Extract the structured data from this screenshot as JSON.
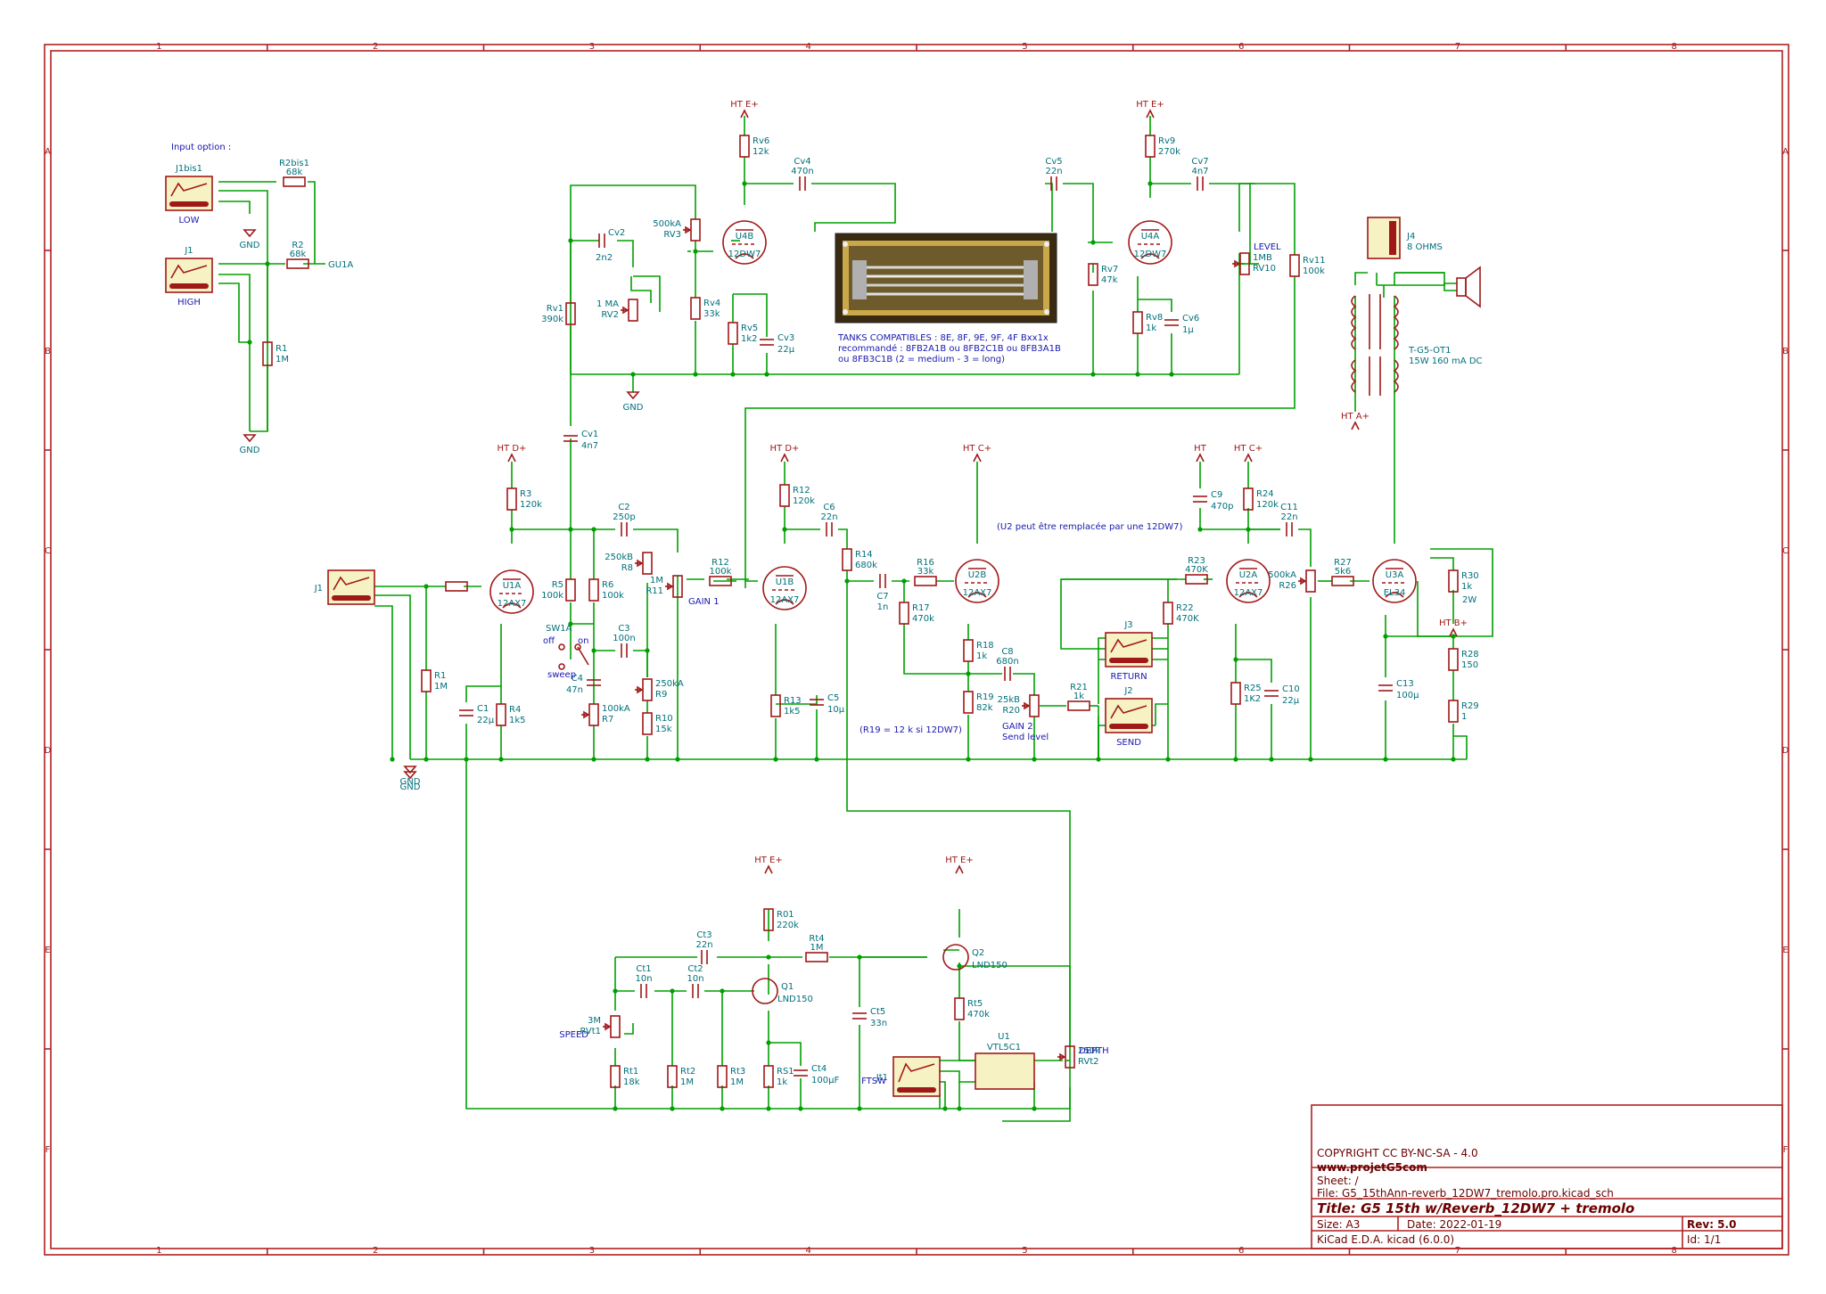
{
  "title_block": {
    "copyright": "COPYRIGHT   CC BY-NC-SA - 4.0",
    "website": "www.projetG5com",
    "sheet": "Sheet: /",
    "file": "File: G5_15thAnn-reverb_12DW7_tremolo.pro.kicad_sch",
    "title": "Title: G5 15th w/Reverb_12DW7 + tremolo",
    "size": "Size: A3",
    "date": "Date: 2022-01-19",
    "rev": "Rev: 5.0",
    "tool": "KiCad E.D.A.  kicad (6.0.0)",
    "id": "Id: 1/1"
  },
  "grid": {
    "columns": [
      "1",
      "2",
      "3",
      "4",
      "5",
      "6",
      "7",
      "8"
    ],
    "rows": [
      "A",
      "B",
      "C",
      "D",
      "E",
      "F"
    ]
  },
  "notes": {
    "input_option": "Input option :",
    "tanks_1": "TANKS COMPATIBLES :  8E, 8F, 9E, 9F, 4F     Bxx1x",
    "tanks_2": "recommandé :   8FB2A1B ou 8FB2C1B ou 8FB3A1B",
    "tanks_3": "ou 8FB3C1B   (2 = medium -  3 = long)",
    "u2_note": "(U2 peut être remplacée par une 12DW7)",
    "r19_note": "(R19 = 12 k si 12DW7)",
    "level": "LEVEL",
    "gain1": "GAIN 1",
    "gain2": "GAIN 2",
    "send_level": "Send level",
    "speed": "SPEED",
    "depth": "DEPTH",
    "low": "LOW",
    "high": "HIGH",
    "return": "RETURN",
    "send": "SEND",
    "ftsw": "FTSW",
    "sw_off": "off",
    "sw_on": "on",
    "sw_sweep": "sweep"
  },
  "nets": {
    "gnd": "GND",
    "ht_e": "HT E+",
    "ht_d": "HT D+",
    "ht_c": "HT C+",
    "ht_b": "HT B+",
    "ht_a": "HT A+",
    "ht": "HT",
    "gu1a": "GU1A"
  },
  "components": [
    {
      "ref": "J1bis1",
      "value": ""
    },
    {
      "ref": "J1",
      "value": ""
    },
    {
      "ref": "R2bis1",
      "value": "68k"
    },
    {
      "ref": "R2",
      "value": "68k"
    },
    {
      "ref": "R1",
      "value": "1M"
    },
    {
      "ref": "Rv1",
      "value": "390k"
    },
    {
      "ref": "Cv2",
      "value": "2n2"
    },
    {
      "ref": "RV2",
      "value": "1 MA"
    },
    {
      "ref": "RV3",
      "value": "500kA"
    },
    {
      "ref": "Rv4",
      "value": "33k"
    },
    {
      "ref": "Rv5",
      "value": "1k2"
    },
    {
      "ref": "Cv3",
      "value": "22µ"
    },
    {
      "ref": "Rv6",
      "value": "12k"
    },
    {
      "ref": "U4B",
      "value": "12DW7"
    },
    {
      "ref": "Cv4",
      "value": "470n"
    },
    {
      "ref": "Cv5",
      "value": "22n"
    },
    {
      "ref": "Rv7",
      "value": "47k"
    },
    {
      "ref": "U4A",
      "value": "12DW7"
    },
    {
      "ref": "Rv8",
      "value": "1k"
    },
    {
      "ref": "Cv6",
      "value": "1µ"
    },
    {
      "ref": "Rv9",
      "value": "270k"
    },
    {
      "ref": "Cv7",
      "value": "4n7"
    },
    {
      "ref": "RV10",
      "value": "1MB"
    },
    {
      "ref": "Rv11",
      "value": "100k"
    },
    {
      "ref": "Cv1",
      "value": "4n7"
    },
    {
      "ref": "J4",
      "value": "8 OHMS"
    },
    {
      "ref": "T-G5-OT1",
      "value": "15W 160 mA DC"
    },
    {
      "ref": "R3",
      "value": "120k"
    },
    {
      "ref": "U1A",
      "value": "12AX7"
    },
    {
      "ref": "R4",
      "value": "1k5"
    },
    {
      "ref": "C1",
      "value": "22µ"
    },
    {
      "ref": "R5",
      "value": "100k"
    },
    {
      "ref": "R6",
      "value": "100k"
    },
    {
      "ref": "C2",
      "value": "250p"
    },
    {
      "ref": "R8",
      "value": "250kB"
    },
    {
      "ref": "C3",
      "value": "100n"
    },
    {
      "ref": "R9",
      "value": "250kA"
    },
    {
      "ref": "C4",
      "value": "47n"
    },
    {
      "ref": "R7",
      "value": "100kA"
    },
    {
      "ref": "R10",
      "value": "15k"
    },
    {
      "ref": "SW1A",
      "value": ""
    },
    {
      "ref": "R11",
      "value": "1M"
    },
    {
      "ref": "R12",
      "value": "100k"
    },
    {
      "ref": "U1B",
      "value": "12AX7"
    },
    {
      "ref": "R12",
      "value": "120k"
    },
    {
      "ref": "C6",
      "value": "22n"
    },
    {
      "ref": "R13",
      "value": "1k5"
    },
    {
      "ref": "C5",
      "value": "10µ"
    },
    {
      "ref": "R14",
      "value": "680k"
    },
    {
      "ref": "C7",
      "value": "1n"
    },
    {
      "ref": "R16",
      "value": "33k"
    },
    {
      "ref": "R17",
      "value": "470k"
    },
    {
      "ref": "U2B",
      "value": "12AX7"
    },
    {
      "ref": "R18",
      "value": "1k"
    },
    {
      "ref": "R19",
      "value": "82k"
    },
    {
      "ref": "C8",
      "value": "680n"
    },
    {
      "ref": "R20",
      "value": "25kB"
    },
    {
      "ref": "R21",
      "value": "1k"
    },
    {
      "ref": "J3",
      "value": ""
    },
    {
      "ref": "J2",
      "value": ""
    },
    {
      "ref": "C9",
      "value": "470p"
    },
    {
      "ref": "R24",
      "value": "120k"
    },
    {
      "ref": "C11",
      "value": "22n"
    },
    {
      "ref": "R23",
      "value": "470K"
    },
    {
      "ref": "U2A",
      "value": "12AX7"
    },
    {
      "ref": "R22",
      "value": "470K"
    },
    {
      "ref": "R25",
      "value": "1K2"
    },
    {
      "ref": "C10",
      "value": "22µ"
    },
    {
      "ref": "R26",
      "value": "500kA"
    },
    {
      "ref": "R27",
      "value": "5k6"
    },
    {
      "ref": "U3A",
      "value": "EL34"
    },
    {
      "ref": "R30",
      "value": "1k"
    },
    {
      "ref": "R28",
      "value": "150"
    },
    {
      "ref": "R29",
      "value": "1"
    },
    {
      "ref": "C13",
      "value": "100µ"
    },
    {
      "ref": "R01",
      "value": "220k"
    },
    {
      "ref": "Ct3",
      "value": "22n"
    },
    {
      "ref": "Rt4",
      "value": "1M"
    },
    {
      "ref": "Q1",
      "value": "LND150"
    },
    {
      "ref": "Q2",
      "value": "LND150"
    },
    {
      "ref": "Ct1",
      "value": "10n"
    },
    {
      "ref": "Ct2",
      "value": "10n"
    },
    {
      "ref": "RVt1",
      "value": "3M"
    },
    {
      "ref": "Rt1",
      "value": "18k"
    },
    {
      "ref": "Rt2",
      "value": "1M"
    },
    {
      "ref": "Rt3",
      "value": "1M"
    },
    {
      "ref": "RS1",
      "value": "1k"
    },
    {
      "ref": "Ct4",
      "value": "100µF"
    },
    {
      "ref": "Ct5",
      "value": "33n"
    },
    {
      "ref": "Rt5",
      "value": "470k"
    },
    {
      "ref": "U1",
      "value": "VTL5C1"
    },
    {
      "ref": "RVt2",
      "value": "250k"
    },
    {
      "ref": "Jt1",
      "value": ""
    }
  ],
  "extra_labels": {
    "r30_power": "2W",
    "cv1_val": "4n7",
    "c4_ref": "C4",
    "c4_val": "47n"
  }
}
